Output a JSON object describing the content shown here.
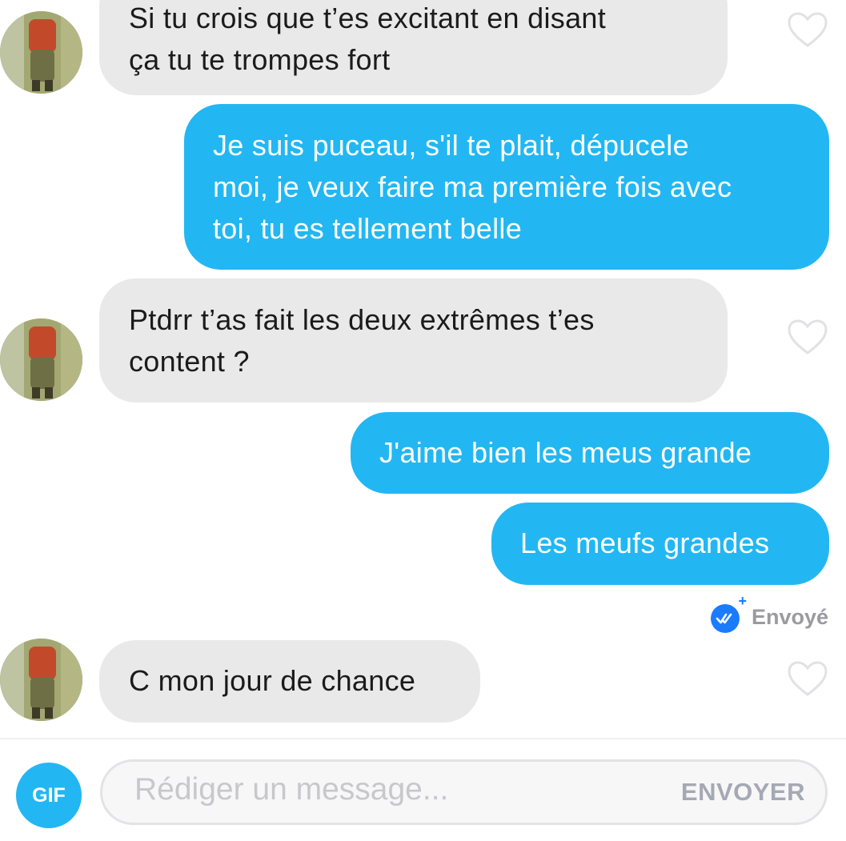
{
  "conversation": {
    "messages": [
      {
        "direction": "in",
        "lines": [
          "Si tu crois que t’es excitant en disant",
          "ça tu te trompes fort"
        ]
      },
      {
        "direction": "out",
        "lines": [
          "Je suis puceau, s'il te plait, dépucele",
          "moi, je veux faire ma première fois avec",
          "toi, tu es tellement belle"
        ]
      },
      {
        "direction": "in",
        "lines": [
          "Ptdrr t’as fait les deux extrêmes t’es",
          "content ?"
        ]
      },
      {
        "direction": "out",
        "lines": [
          "J'aime bien les meus grande"
        ]
      },
      {
        "direction": "out",
        "lines": [
          "Les meufs grandes"
        ]
      },
      {
        "direction": "in",
        "lines": [
          "C mon jour de chance"
        ]
      }
    ],
    "status": {
      "label": "Envoyé",
      "icon": "double-check-icon",
      "badge": "+"
    }
  },
  "composer": {
    "gif_label": "GIF",
    "placeholder": "Rédiger un message...",
    "send_label": "ENVOYER"
  },
  "colors": {
    "outgoing_bubble": "#22b7f2",
    "incoming_bubble": "#e9e9ea",
    "status_icon": "#1b7bff"
  }
}
